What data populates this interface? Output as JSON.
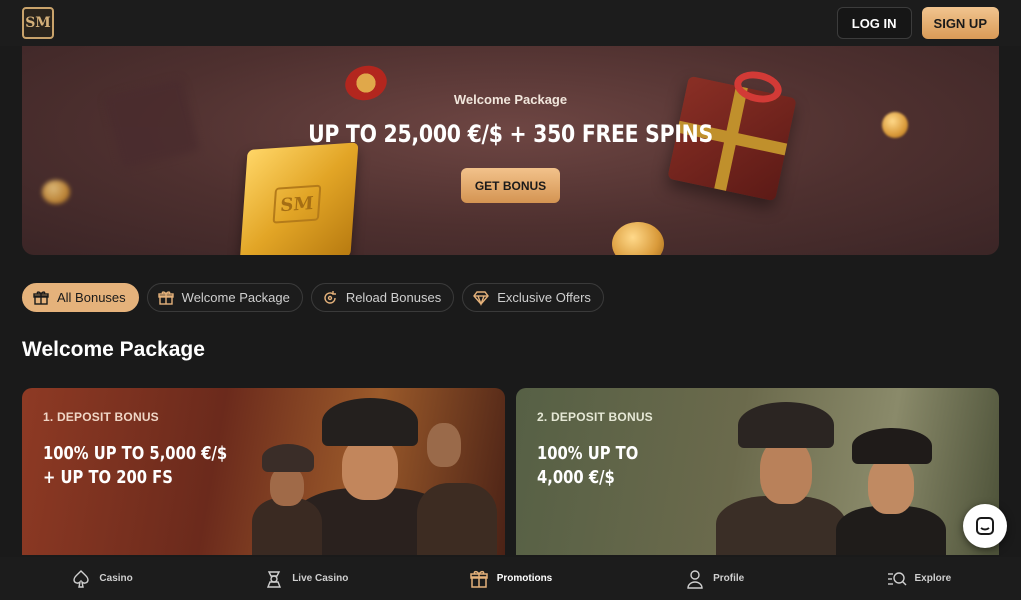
{
  "header": {
    "logo_text": "SM",
    "login_label": "LOG IN",
    "signup_label": "SIGN UP"
  },
  "banner": {
    "title": "Welcome Package",
    "headline": "UP TO 25,000 €/$ + 350 FREE SPINS",
    "cta_label": "GET BONUS",
    "gold_bar_stamp": "SM"
  },
  "tabs": [
    {
      "label": "All Bonuses",
      "icon": "gift-icon",
      "active": true
    },
    {
      "label": "Welcome Package",
      "icon": "gift-icon",
      "active": false
    },
    {
      "label": "Reload Bonuses",
      "icon": "reload-icon",
      "active": false
    },
    {
      "label": "Exclusive Offers",
      "icon": "diamond-icon",
      "active": false
    }
  ],
  "section": {
    "title": "Welcome Package"
  },
  "cards": [
    {
      "label": "1. DEPOSIT BONUS",
      "offer_line1": "100% UP TO 5,000 €/$",
      "offer_line2": "+ UP TO 200 FS"
    },
    {
      "label": "2. DEPOSIT BONUS",
      "offer_line1": "100% UP TO",
      "offer_line2": "4,000 €/$"
    }
  ],
  "bottom_nav": [
    {
      "label": "Casino",
      "icon": "spade-icon",
      "active": false
    },
    {
      "label": "Live Casino",
      "icon": "dealer-icon",
      "active": false
    },
    {
      "label": "Promotions",
      "icon": "gift-icon",
      "active": true
    },
    {
      "label": "Profile",
      "icon": "user-icon",
      "active": false
    },
    {
      "label": "Explore",
      "icon": "search-list-icon",
      "active": false
    }
  ],
  "colors": {
    "accent": "#e5b27b",
    "background": "#1a1a1a"
  }
}
